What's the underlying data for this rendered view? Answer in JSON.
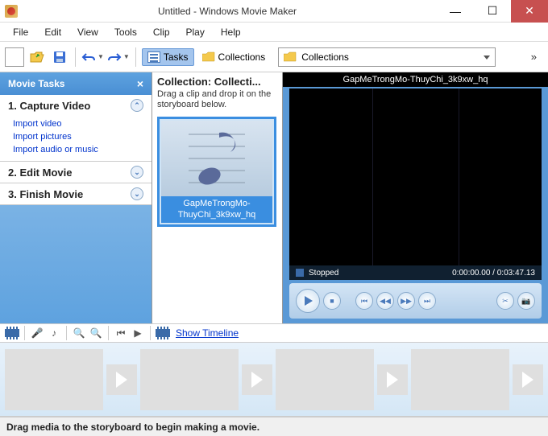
{
  "titlebar": {
    "title": "Untitled - Windows Movie Maker"
  },
  "menu": {
    "file": "File",
    "edit": "Edit",
    "view": "View",
    "tools": "Tools",
    "clip": "Clip",
    "play": "Play",
    "help": "Help"
  },
  "toolbar": {
    "tasks": "Tasks",
    "collections": "Collections",
    "collection_selected": "Collections"
  },
  "sidebar": {
    "title": "Movie Tasks",
    "groups": [
      {
        "title": "1. Capture Video",
        "links": [
          "Import video",
          "Import pictures",
          "Import audio or music"
        ]
      },
      {
        "title": "2. Edit Movie",
        "links": []
      },
      {
        "title": "3. Finish Movie",
        "links": []
      }
    ]
  },
  "collection": {
    "header": "Collection: Collecti...",
    "hint": "Drag a clip and drop it on the storyboard below.",
    "clip_name": "GapMeTrongMo-ThuyChi_3k9xw_hq"
  },
  "preview": {
    "title": "GapMeTrongMo-ThuyChi_3k9xw_hq",
    "status": "Stopped",
    "time": "0:00:00.00 / 0:03:47.13"
  },
  "timeline": {
    "show": "Show Timeline"
  },
  "statusbar": {
    "text": "Drag media to the storyboard to begin making a movie."
  }
}
